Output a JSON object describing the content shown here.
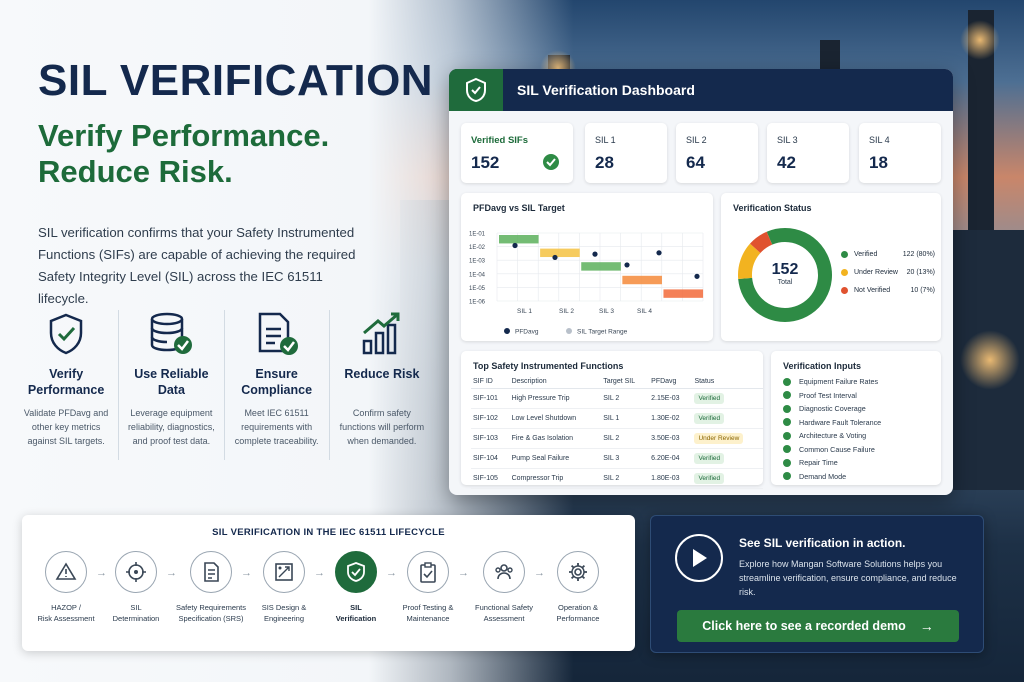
{
  "hero": {
    "title": "SIL VERIFICATION",
    "subtitle_line1": "Verify Performance.",
    "subtitle_line2": "Reduce Risk.",
    "description": "SIL verification confirms that your Safety Instrumented Functions (SIFs) are capable of achieving the required Safety Integrity Level (SIL) across the IEC 61511 lifecycle."
  },
  "pillars": [
    {
      "icon": "shield-check-icon",
      "title": "Verify Performance",
      "desc": "Validate PFDavg and other key metrics against SIL targets."
    },
    {
      "icon": "database-check-icon",
      "title": "Use Reliable Data",
      "desc": "Leverage equipment reliability, diagnostics, and proof test data."
    },
    {
      "icon": "document-check-icon",
      "title": "Ensure Compliance",
      "desc": "Meet IEC 61511 requirements with complete traceability."
    },
    {
      "icon": "bar-chart-rising-icon",
      "title": "Reduce Risk",
      "desc": "Confirm safety functions will perform when demanded."
    }
  ],
  "dashboard": {
    "title": "SIL Verification Dashboard",
    "stats": [
      {
        "label": "Verified SIFs",
        "value": "152"
      },
      {
        "label": "SIL 1",
        "value": "28"
      },
      {
        "label": "SIL 2",
        "value": "64"
      },
      {
        "label": "SIL 3",
        "value": "42"
      },
      {
        "label": "SIL 4",
        "value": "18"
      }
    ],
    "pfd_chart": {
      "title": "PFDavg vs SIL Target",
      "y_ticks": [
        "1E-01",
        "1E-02",
        "1E-03",
        "1E-04",
        "1E-05",
        "1E-06"
      ],
      "x_ticks": [
        "SIL 1",
        "SIL 2",
        "SIL 3",
        "SIL 4"
      ],
      "legend_pfd": "PFDavg",
      "legend_range": "SIL Target Range"
    },
    "status": {
      "title": "Verification Status",
      "total_value": "152",
      "total_label": "Total",
      "items": [
        {
          "label": "Verified",
          "value": "122 (80%)",
          "color": "#2e8b45"
        },
        {
          "label": "Under Review",
          "value": "20 (13%)",
          "color": "#f2b320"
        },
        {
          "label": "Not Verified",
          "value": "10  (7%)",
          "color": "#e0522f"
        }
      ]
    },
    "sif_table": {
      "title": "Top Safety Instrumented Functions",
      "headers": [
        "SIF ID",
        "Description",
        "Target SIL",
        "PFDavg",
        "Status"
      ],
      "rows": [
        [
          "SIF-101",
          "High Pressure Trip",
          "SIL 2",
          "2.15E-03",
          "Verified"
        ],
        [
          "SIF-102",
          "Low Level Shutdown",
          "SIL 1",
          "1.30E-02",
          "Verified"
        ],
        [
          "SIF-103",
          "Fire & Gas Isolation",
          "SIL 2",
          "3.50E-03",
          "Under Review"
        ],
        [
          "SIF-104",
          "Pump Seal Failure",
          "SIL 3",
          "6.20E-04",
          "Verified"
        ],
        [
          "SIF-105",
          "Compressor Trip",
          "SIL 2",
          "1.80E-03",
          "Verified"
        ]
      ]
    },
    "inputs": {
      "title": "Verification Inputs",
      "items": [
        "Equipment Failure Rates",
        "Proof Test Interval",
        "Diagnostic Coverage",
        "Hardware Fault Tolerance",
        "Architecture & Voting",
        "Common Cause Failure",
        "Repair Time",
        "Demand Mode"
      ]
    }
  },
  "chart_data": {
    "type": "bar",
    "title": "PFDavg vs SIL Target",
    "categories": [
      "SIL 1",
      "SIL 2",
      "SIL 3",
      "SIL 4"
    ],
    "y_scale": "log",
    "ylim": [
      1e-06,
      0.1
    ],
    "series": [
      {
        "name": "SIL Target Range",
        "ranges": [
          [
            0.01,
            0.1
          ],
          [
            0.001,
            0.01
          ],
          [
            0.0001,
            0.001
          ],
          [
            1e-05,
            0.0001
          ]
        ],
        "colors": [
          "#5cb05c",
          "#f5c242",
          "#5cb05c",
          "#f58a3a",
          "#f26a3a"
        ]
      },
      {
        "name": "PFDavg",
        "values": [
          0.013,
          0.0021,
          0.0035,
          0.00062,
          0.0018,
          1.8e-05
        ]
      }
    ],
    "bands": [
      {
        "label": "SIL 1",
        "low": 0.01,
        "high": 0.1,
        "color": "#5cb05c"
      },
      {
        "label": "SIL 2",
        "low": 0.001,
        "high": 0.01,
        "color": "#f5c242"
      },
      {
        "label": "SIL 3",
        "low": 0.0001,
        "high": 0.001,
        "color": "#5cb05c"
      },
      {
        "label": "",
        "low": 1e-05,
        "high": 0.0001,
        "color": "#f58a3a"
      },
      {
        "label": "SIL 4",
        "low": 1e-06,
        "high": 1e-05,
        "color": "#f26a3a"
      }
    ],
    "points": [
      0.012,
      0.0016,
      0.0028,
      0.00045,
      0.0035,
      6.5e-05
    ]
  },
  "lifecycle": {
    "title": "SIL VERIFICATION IN THE IEC 61511 LIFECYCLE",
    "steps": [
      {
        "icon": "warning-triangle-icon",
        "l1": "HAZOP /",
        "l2": "Risk Assessment"
      },
      {
        "icon": "crosshair-icon",
        "l1": "SIL",
        "l2": "Determination"
      },
      {
        "icon": "document-icon",
        "l1": "Safety Requirements",
        "l2": "Specification (SRS)"
      },
      {
        "icon": "design-icon",
        "l1": "SIS Design &",
        "l2": "Engineering"
      },
      {
        "icon": "shield-check-icon",
        "l1": "SIL",
        "l2": "Verification"
      },
      {
        "icon": "clipboard-check-icon",
        "l1": "Proof Testing &",
        "l2": "Maintenance"
      },
      {
        "icon": "people-icon",
        "l1": "Functional Safety",
        "l2": "Assessment"
      },
      {
        "icon": "gear-icon",
        "l1": "Operation &",
        "l2": "Performance"
      }
    ]
  },
  "demo": {
    "title": "See SIL verification in action.",
    "description": "Explore how Mangan Software Solutions helps you streamline verification, ensure compliance, and reduce risk.",
    "button": "Click here to see a recorded demo",
    "button_arrow": "→"
  },
  "colors": {
    "navy": "#14294d",
    "green": "#1f6b3c",
    "accent_green": "#2e8b45",
    "amber": "#f2b320",
    "red": "#e0522f"
  }
}
